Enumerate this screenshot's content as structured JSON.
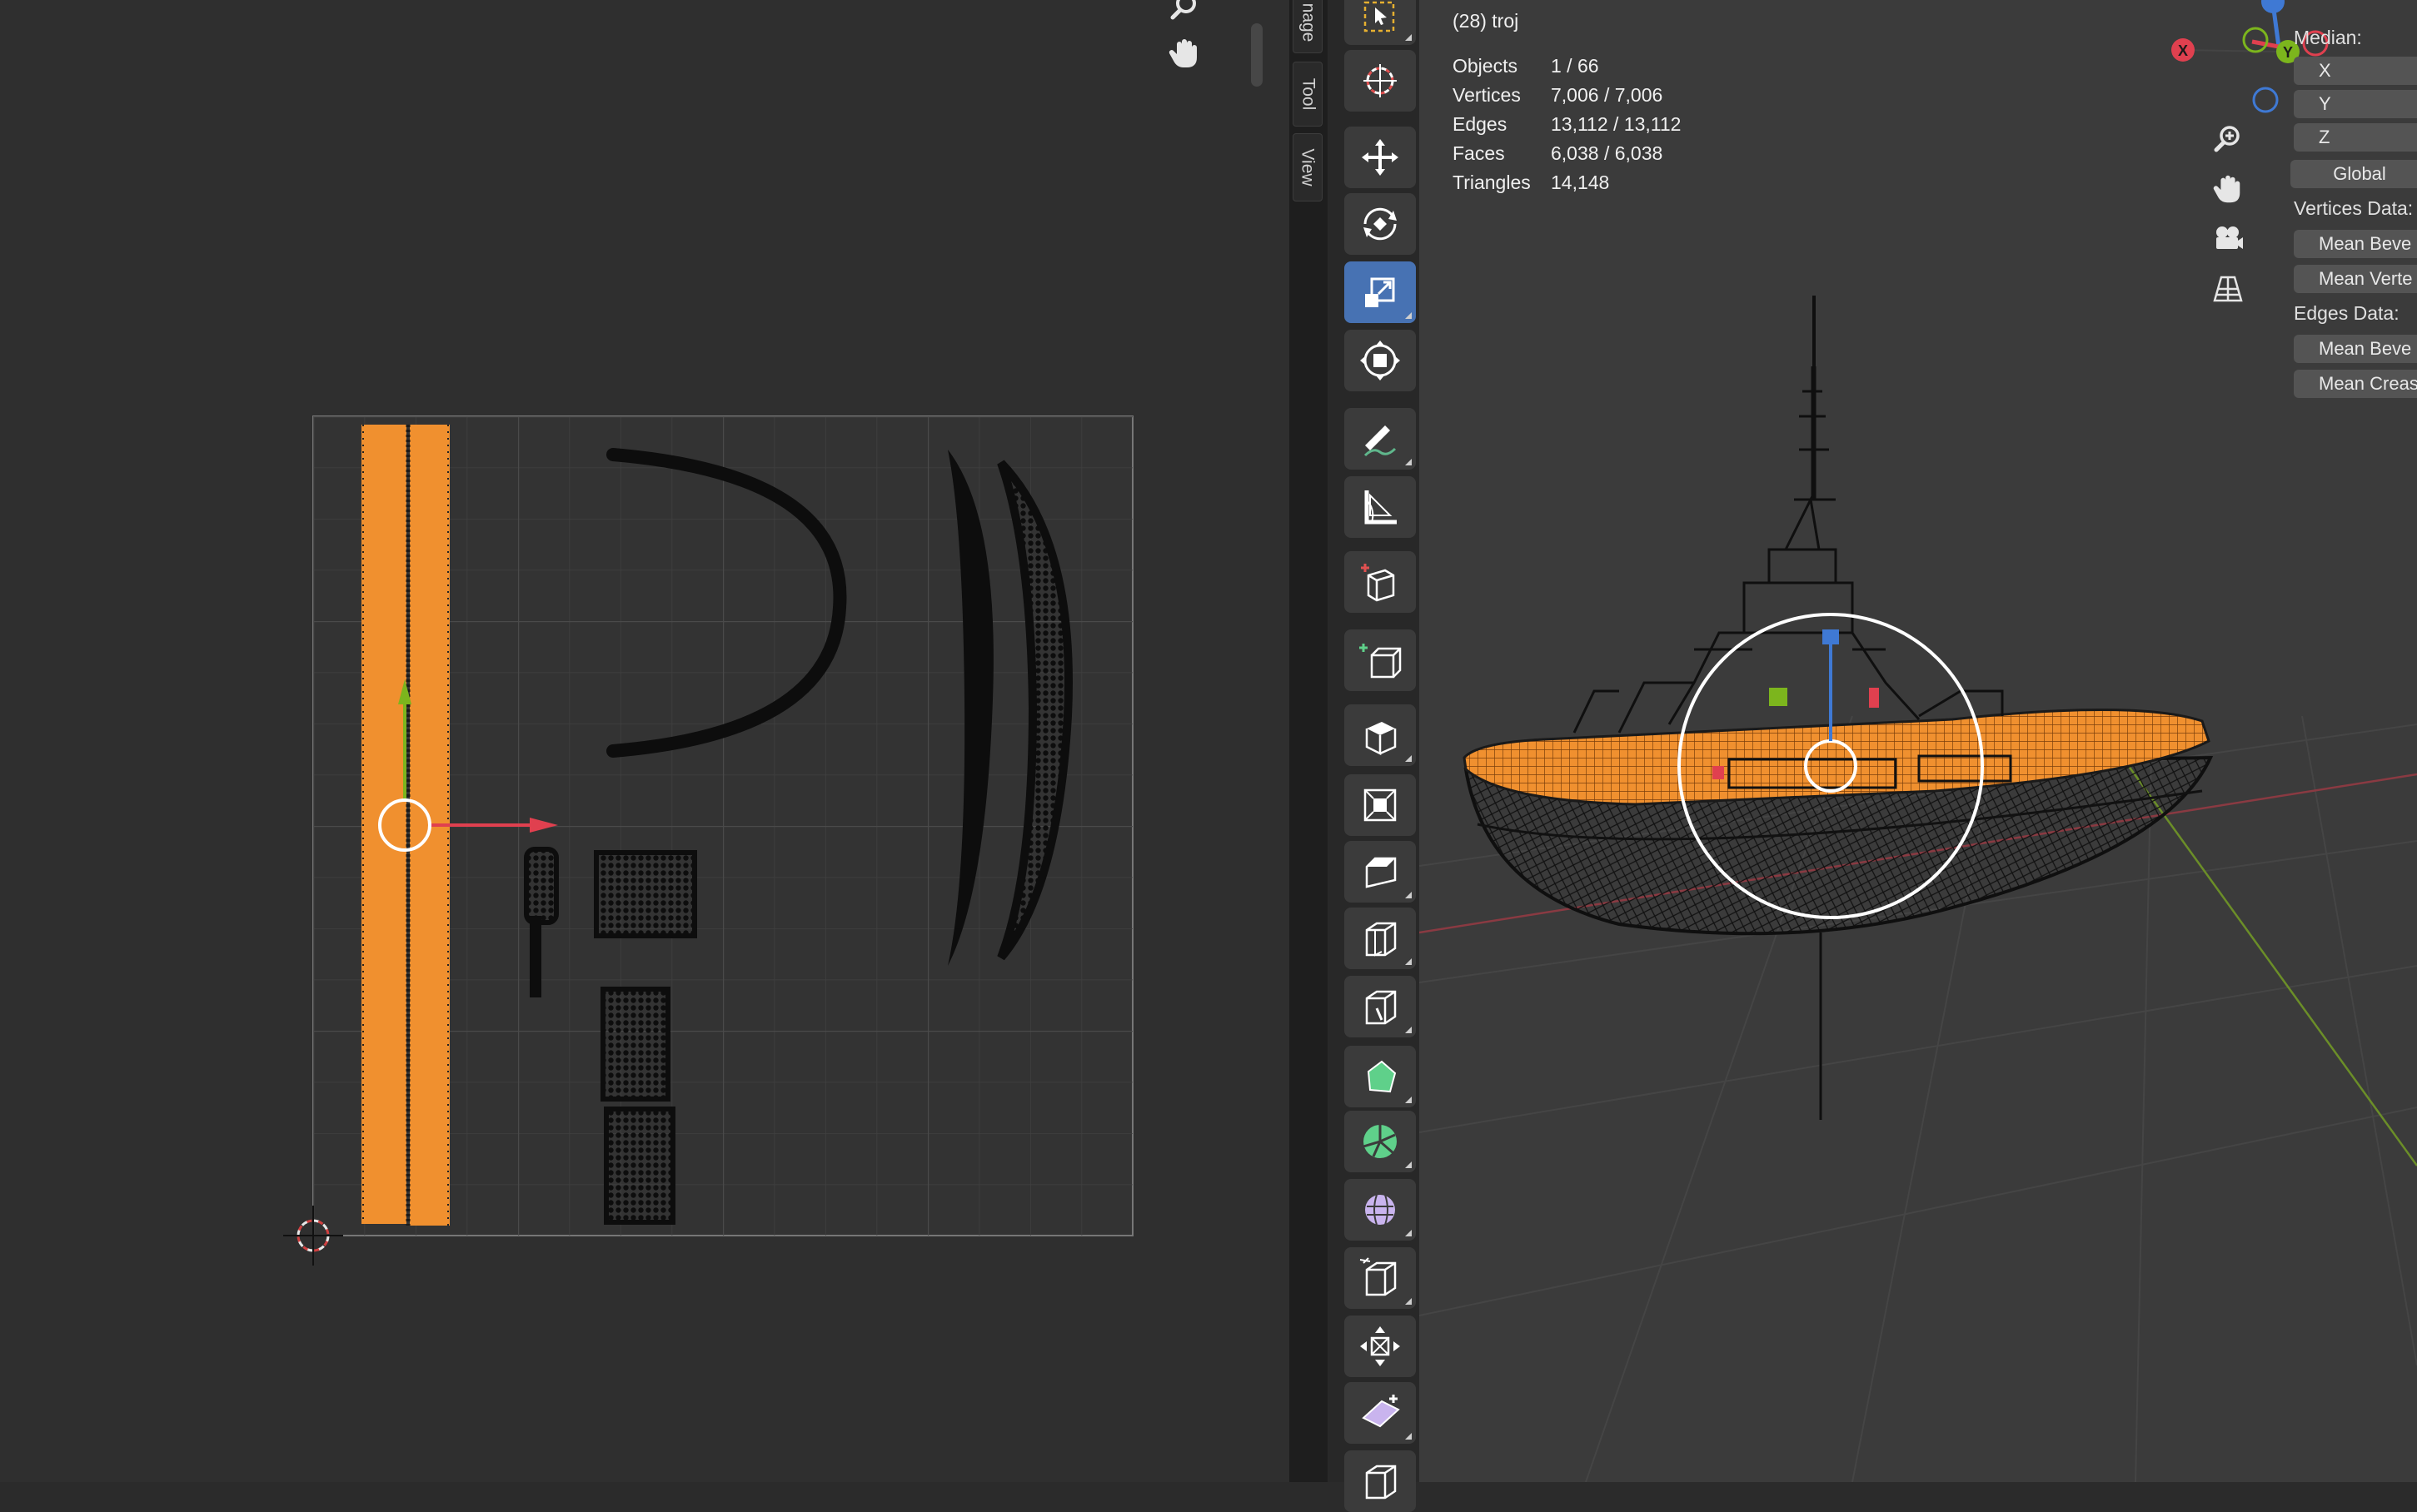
{
  "uv_editor": {
    "tabs": [
      {
        "label": "nage"
      },
      {
        "label": "Tool"
      },
      {
        "label": "View"
      }
    ]
  },
  "toolbar": {
    "tools": [
      {
        "name": "select-box-icon"
      },
      {
        "name": "cursor-icon"
      },
      {
        "name": "move-icon"
      },
      {
        "name": "rotate-icon"
      },
      {
        "name": "scale-icon",
        "active": true
      },
      {
        "name": "transform-icon"
      },
      {
        "name": "annotate-icon"
      },
      {
        "name": "measure-icon"
      },
      {
        "name": "add-cube-icon"
      },
      {
        "name": "extrude-region-icon"
      },
      {
        "name": "extrude-icon"
      },
      {
        "name": "inset-faces-icon"
      },
      {
        "name": "bevel-icon"
      },
      {
        "name": "loop-cut-icon"
      },
      {
        "name": "knife-icon"
      },
      {
        "name": "poly-build-icon"
      },
      {
        "name": "spin-icon"
      },
      {
        "name": "smooth-icon"
      },
      {
        "name": "edge-slide-icon"
      },
      {
        "name": "shrink-fatten-icon"
      },
      {
        "name": "shear-icon"
      },
      {
        "name": "rip-region-icon"
      }
    ]
  },
  "viewport": {
    "object_title": "(28) troj",
    "stats": [
      {
        "label": "Objects",
        "value": "1 / 66"
      },
      {
        "label": "Vertices",
        "value": "7,006 / 7,006"
      },
      {
        "label": "Edges",
        "value": "13,112 / 13,112"
      },
      {
        "label": "Faces",
        "value": "6,038 / 6,038"
      },
      {
        "label": "Triangles",
        "value": "14,148"
      }
    ],
    "gizmo_axes": {
      "x": "X",
      "y": "Y"
    }
  },
  "n_panel": {
    "median_label": "Median:",
    "fields": {
      "x": "X",
      "y": "Y",
      "z": "Z"
    },
    "space": "Global",
    "vertices_data_label": "Vertices Data:",
    "vertices_fields": [
      "Mean Beve",
      "Mean Verte"
    ],
    "edges_data_label": "Edges Data:",
    "edges_fields": [
      "Mean Beve",
      "Mean Creas"
    ]
  },
  "colors": {
    "selection": "#f0902f",
    "axis_x": "#e0404f",
    "axis_y": "#7cb51d",
    "axis_z": "#3f79d4",
    "active_tool": "#4772b3"
  }
}
